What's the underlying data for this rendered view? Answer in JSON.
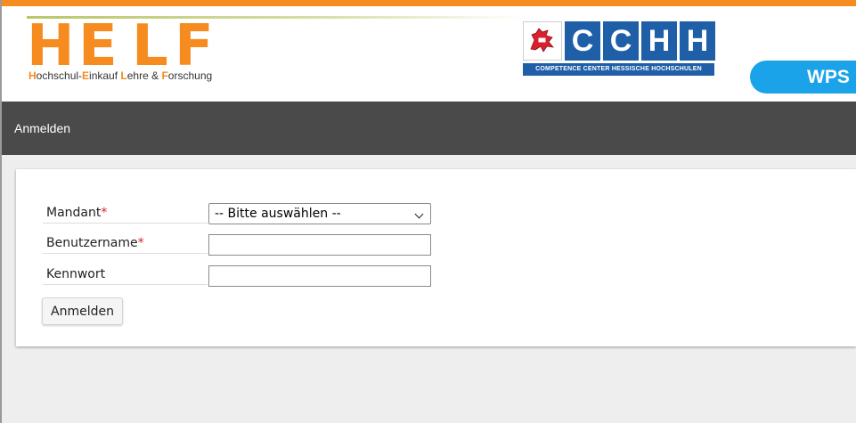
{
  "header": {
    "helf_letters": [
      "H",
      "E",
      "L",
      "F"
    ],
    "helf_subtitle": {
      "parts": [
        {
          "text": "H",
          "highlight": true
        },
        {
          "text": "ochschul-",
          "highlight": false
        },
        {
          "text": "E",
          "highlight": true
        },
        {
          "text": "inkauf ",
          "highlight": false
        },
        {
          "text": "L",
          "highlight": true
        },
        {
          "text": "ehre & ",
          "highlight": false
        },
        {
          "text": "F",
          "highlight": true
        },
        {
          "text": "orschung",
          "highlight": false
        }
      ]
    },
    "cchh_letters": [
      "C",
      "C",
      "H",
      "H"
    ],
    "cchh_subtitle": "COMPETENCE CENTER HESSISCHE HOCHSCHULEN",
    "wps_label": "WPS",
    "colors": {
      "orange": "#f68b1f",
      "cchh_blue": "#1f5fa8",
      "wps_blue": "#1aa3e8",
      "nav_bg": "#4a4a4a"
    }
  },
  "nav": {
    "login_label": "Anmelden"
  },
  "form": {
    "mandant": {
      "label": "Mandant",
      "required_mark": "*",
      "selected_value": "-- Bitte auswählen --"
    },
    "username": {
      "label": "Benutzername",
      "required_mark": "*",
      "value": ""
    },
    "password": {
      "label": "Kennwort",
      "value": ""
    },
    "submit_label": "Anmelden"
  }
}
